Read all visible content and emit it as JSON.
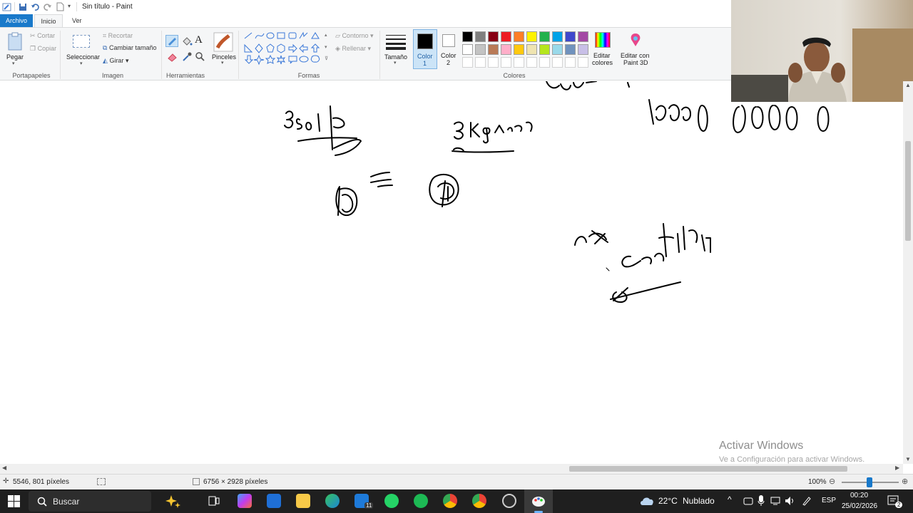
{
  "window": {
    "title": "Sin título - Paint"
  },
  "tabs": [
    "Archivo",
    "Inicio",
    "Ver"
  ],
  "ribbon": {
    "portapapeles": {
      "pegar": "Pegar",
      "cortar": "Cortar",
      "copiar": "Copiar",
      "label": "Portapapeles"
    },
    "imagen": {
      "seleccionar": "Seleccionar",
      "recortar": "Recortar",
      "cambiar_tamano": "Cambiar tamaño",
      "girar": "Girar",
      "label": "Imagen"
    },
    "herramientas": {
      "label": "Herramientas",
      "text_tool": "A"
    },
    "pinceles": {
      "label": "Pinceles"
    },
    "formas": {
      "label": "Formas",
      "contorno": "Contorno",
      "rellenar": "Rellenar"
    },
    "tamano": {
      "label": "Tamaño"
    },
    "color1": {
      "label": "Color",
      "sub": "1"
    },
    "color2": {
      "label": "Color",
      "sub": "2"
    },
    "colores": {
      "label": "Colores",
      "editar_colores_1": "Editar",
      "editar_colores_2": "colores",
      "paint3d_1": "Editar con",
      "paint3d_2": "Paint 3D",
      "row1": [
        "#000000",
        "#7f7f7f",
        "#880015",
        "#ed1c24",
        "#ff7f27",
        "#fff200",
        "#22b14c",
        "#00a2e8",
        "#3f48cc",
        "#a349a4"
      ],
      "row2": [
        "#ffffff",
        "#c3c3c3",
        "#b97a57",
        "#ffaec9",
        "#ffc90e",
        "#efe4b0",
        "#b5e61d",
        "#99d9ea",
        "#7092be",
        "#c8bfe7"
      ]
    }
  },
  "canvas": {
    "watermark_title": "Activar Windows",
    "watermark_sub": "Ve a Configuración para activar Windows."
  },
  "status": {
    "cursor_pos": "5546, 801 píxeles",
    "image_size": "6756 × 2928 píxeles",
    "zoom": "100%"
  },
  "taskbar": {
    "search_label": "Buscar",
    "weather_temp": "22°C",
    "weather_text": "Nublado",
    "language": "ESP",
    "time": "00:20",
    "date": "25/02/2026",
    "mail_badge": "11",
    "notif_badge": "2"
  }
}
